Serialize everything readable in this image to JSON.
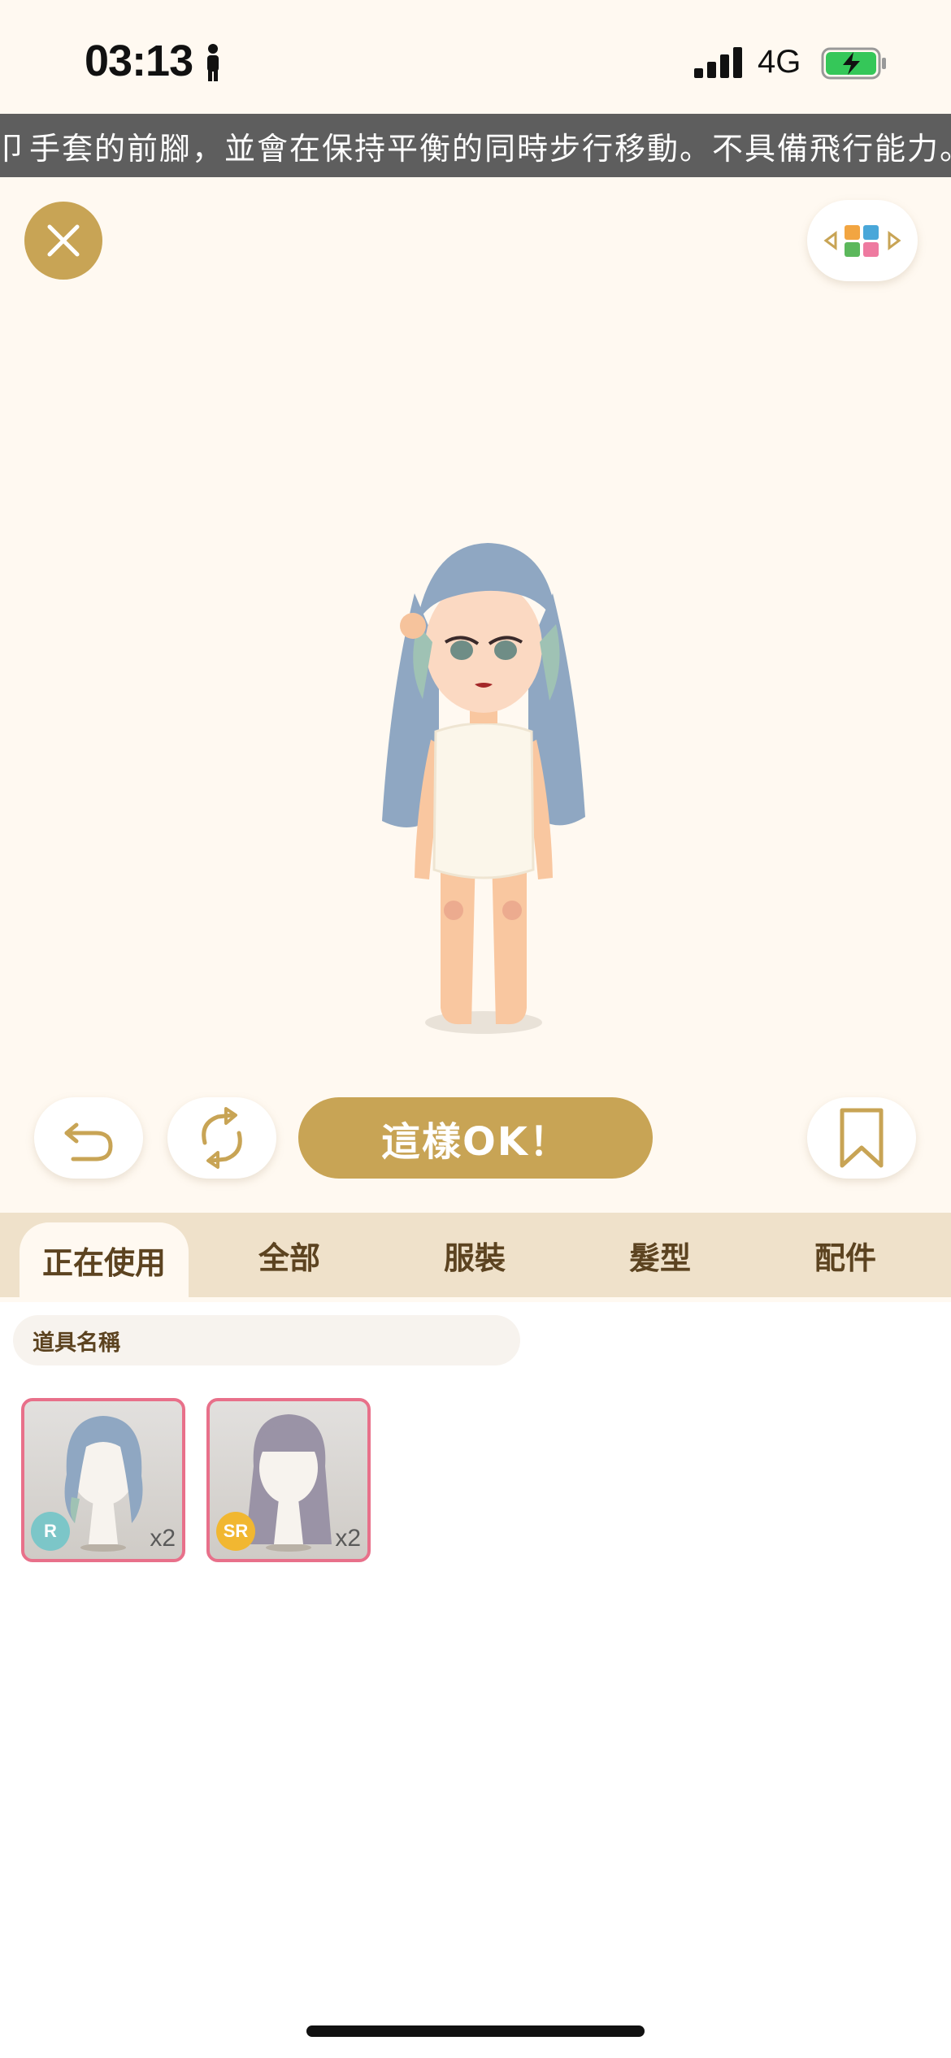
{
  "status_bar": {
    "time": "03:13",
    "network": "4G"
  },
  "marquee": {
    "text": "卩手套的前腳，並會在保持平衡的同時步行移動。不具備飛行能力。智力"
  },
  "toolbar": {
    "ok_label": "這樣OK！"
  },
  "tabs": [
    {
      "label": "正在使用",
      "active": true
    },
    {
      "label": "全部",
      "active": false
    },
    {
      "label": "服裝",
      "active": false
    },
    {
      "label": "髮型",
      "active": false
    },
    {
      "label": "配件",
      "active": false
    }
  ],
  "search": {
    "placeholder": "道具名稱"
  },
  "items": [
    {
      "rarity": "R",
      "rarity_color": "#7cc6c8",
      "quantity": "x2",
      "hair_color": "#8fa7c2"
    },
    {
      "rarity": "SR",
      "rarity_color": "#f1b731",
      "quantity": "x2",
      "hair_color": "#9a93a6"
    }
  ],
  "colors": {
    "accent": "#c8a455",
    "background": "#fff9f1",
    "tab_bar": "#efe1ca",
    "item_border": "#e8708a",
    "marquee_bg": "#5e5e5e"
  }
}
